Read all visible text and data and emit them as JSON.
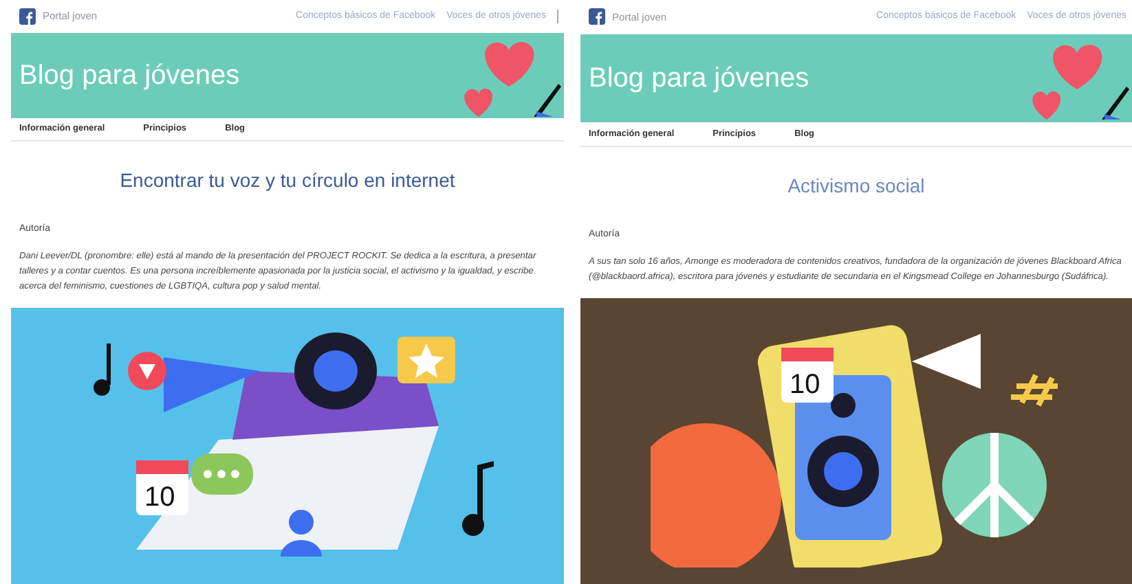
{
  "pages": [
    {
      "portal": "Portal joven",
      "links": [
        "Conceptos básicos de Facebook",
        "Voces de otros jóvenes"
      ],
      "banner_title": "Blog para jóvenes",
      "nav": [
        "Información general",
        "Principios",
        "Blog"
      ],
      "title": "Encontrar tu voz y tu círculo en internet",
      "author_label": "Autoría",
      "bio": "Dani Leever/DL (pronombre: elle) está al mando de la presentación del PROJECT ROCKIT. Se dedica a la escritura, a presentar talleres y a contar cuentos. Es una persona increíblemente apasionada por la justicia social, el activismo y la igualdad, y escribe acerca del feminismo, cuestiones de LGBTIQA, cultura pop y salud mental.",
      "illustration": {
        "kind": "laptop",
        "color": "#55c1ea",
        "calendar_day": "10"
      }
    },
    {
      "portal": "Portal joven",
      "links": [
        "Conceptos básicos de Facebook",
        "Voces de otros jóvenes"
      ],
      "banner_title": "Blog para jóvenes",
      "nav": [
        "Información general",
        "Principios",
        "Blog"
      ],
      "title": "Activismo social",
      "author_label": "Autoría",
      "bio": "A sus tan solo 16 años, Amonge es moderadora de contenidos creativos, fundadora de la organización de jóvenes Blackboard Africa (@blackbaord.africa), escritora para jóvenes y estudiante de secundaria en el Kingsmead College en Johannesburgo (Sudáfrica).",
      "illustration": {
        "kind": "phone",
        "color": "#5a4532",
        "calendar_day": "10"
      }
    }
  ]
}
